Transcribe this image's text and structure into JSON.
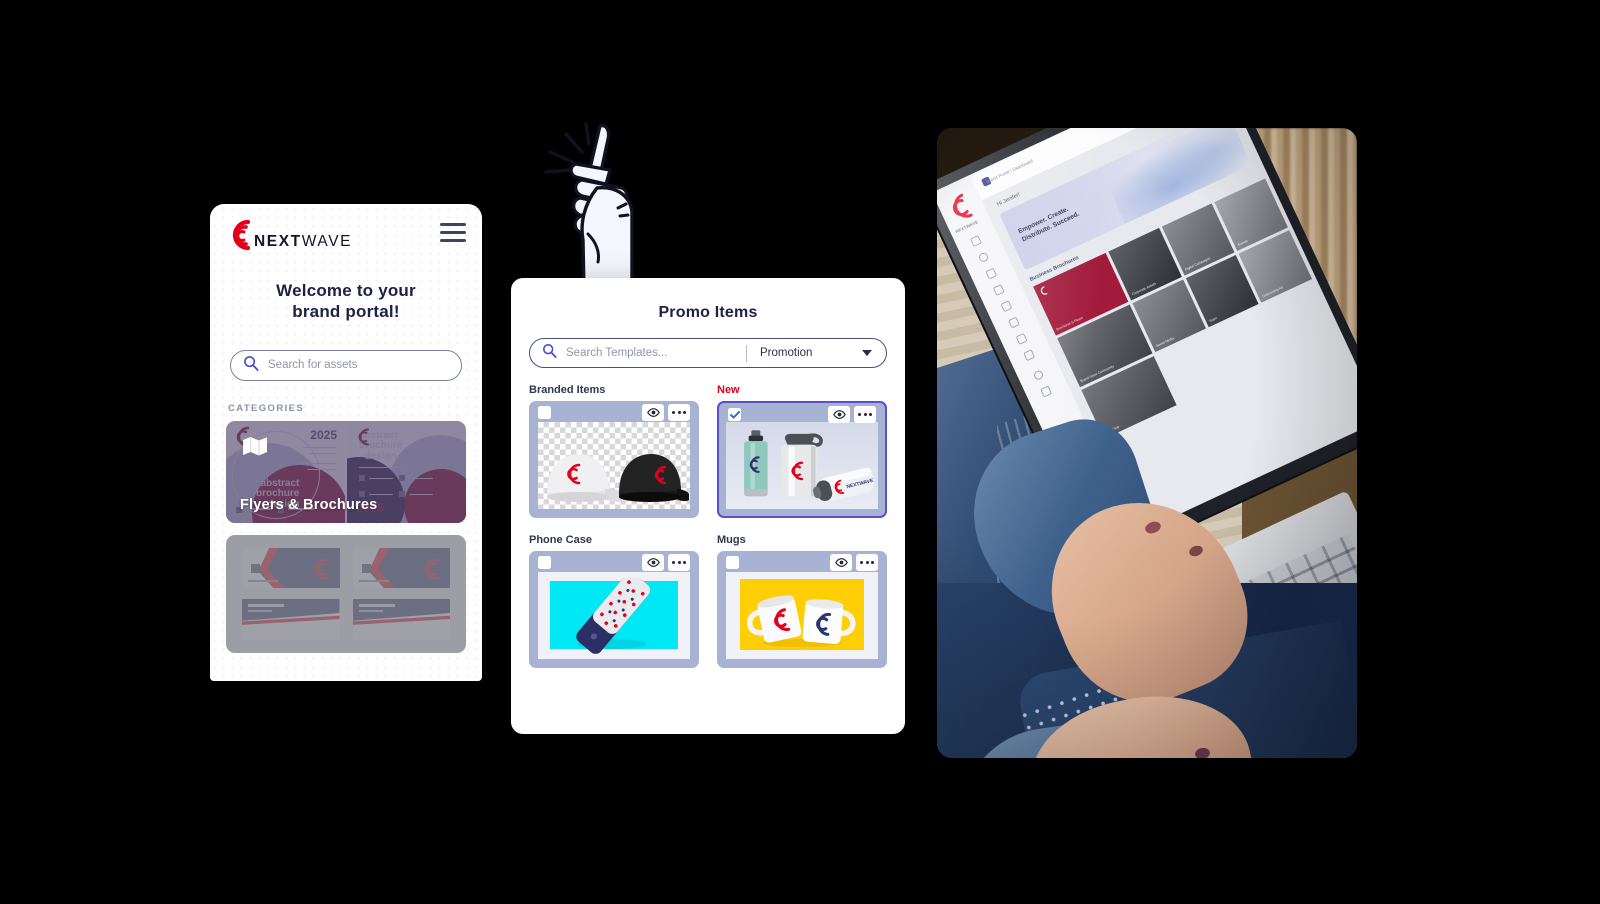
{
  "mobile": {
    "brand": {
      "name_bold": "NEXT",
      "name_light": "WAVE",
      "logo_icon": "nextwave-wave-logo"
    },
    "menu_icon": "hamburger-menu-icon",
    "welcome_line1": "Welcome to your",
    "welcome_line2": "brand portal!",
    "search": {
      "placeholder": "Search for assets",
      "icon": "search-icon"
    },
    "categories_label": "CATEGORIES",
    "categories": [
      {
        "title": "Flyers & Brochures",
        "icon": "folded-map-icon"
      },
      {
        "title": "",
        "icon": ""
      }
    ]
  },
  "promo": {
    "title": "Promo Items",
    "search": {
      "placeholder": "Search Templates...",
      "icon": "search-icon"
    },
    "filter": {
      "value": "Promotion",
      "icon": "chevron-down-icon"
    },
    "items": [
      {
        "label": "Branded Items",
        "label_style": "normal",
        "selected": false,
        "checkbox_icon": "checkbox-unchecked-icon",
        "preview_icon": "eye-icon",
        "more_icon": "more-options-icon",
        "artwork": "caps-grey-and-black-on-transparent-checkerboard"
      },
      {
        "label": "New",
        "label_style": "new",
        "selected": true,
        "checkbox_icon": "checkbox-checked-icon",
        "preview_icon": "eye-icon",
        "more_icon": "more-options-icon",
        "artwork": "three-branded-water-bottles"
      },
      {
        "label": "Phone Case",
        "label_style": "normal",
        "selected": false,
        "checkbox_icon": "checkbox-unchecked-icon",
        "preview_icon": "eye-icon",
        "more_icon": "more-options-icon",
        "artwork": "patterned-phone-case-on-cyan"
      },
      {
        "label": "Mugs",
        "label_style": "normal",
        "selected": false,
        "checkbox_icon": "checkbox-unchecked-icon",
        "preview_icon": "eye-icon",
        "more_icon": "more-options-icon",
        "artwork": "two-branded-white-mugs-on-yellow"
      }
    ]
  },
  "illustration": {
    "name": "pointing-hand-illustration"
  },
  "photo": {
    "name": "woman-using-laptop-on-lap-photo",
    "screen": {
      "brand_label": "NEXTWAVE",
      "breadcrumb": "Brand Portal  /  Dashboard",
      "greeting": "Hi Jenifer!",
      "hero_line1": "Empower. Create.",
      "hero_line2": "Distribute. Succeed.",
      "section_title": "Business Brochures",
      "tiles": [
        {
          "caption": "Brochures & Flyers",
          "style": "brand"
        },
        {
          "caption": "Corporate Assets",
          "style": "g1"
        },
        {
          "caption": "Digital Campaigns",
          "style": "g2"
        },
        {
          "caption": "Events",
          "style": "g3"
        },
        {
          "caption": "Brand Voice Community",
          "style": "g4"
        },
        {
          "caption": "Social Media",
          "style": "g2"
        },
        {
          "caption": "Team",
          "style": "g1"
        },
        {
          "caption": "Onboarding Kit",
          "style": "g3"
        },
        {
          "caption": "Print Shop",
          "style": "g4"
        }
      ]
    }
  },
  "colors": {
    "brand_red": "#e3001b",
    "accent_indigo": "#5a4fcf",
    "tile_bg": "#a8b3d4",
    "text_dark": "#1d2142",
    "canvas": "#000000"
  }
}
